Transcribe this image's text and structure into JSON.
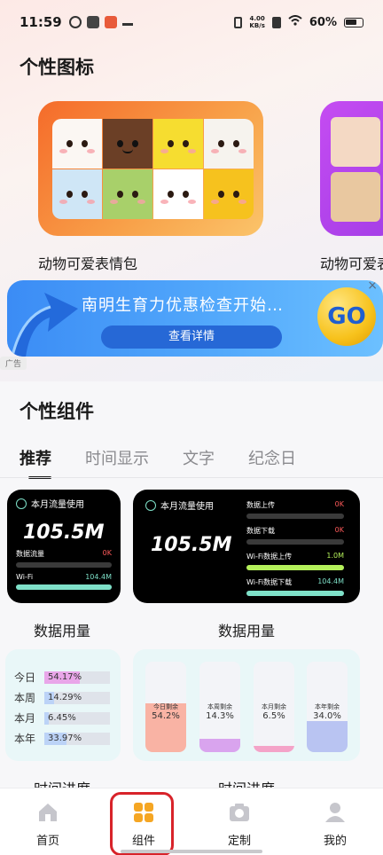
{
  "status_bar": {
    "time": "11:59",
    "speed_value": "4.00",
    "speed_unit": "KB/s",
    "battery": "60%"
  },
  "icons_section": {
    "title": "个性图标",
    "packs": [
      {
        "name": "动物可爱表情包"
      },
      {
        "name": "动物可爱表"
      }
    ]
  },
  "ad": {
    "headline": "南明生育力优惠检查开始…",
    "button_label": "查看详情",
    "go_label": "GO",
    "close_label": "×",
    "tag": "广告"
  },
  "widgets_section": {
    "title": "个性组件",
    "tabs": [
      "推荐",
      "时间显示",
      "文字",
      "纪念日"
    ],
    "active_tab": "推荐"
  },
  "data_widget_small": {
    "header": "本月流量使用",
    "big_value": "105.5M",
    "row1_label": "数据流量",
    "row1_value": "0K",
    "row2_label": "Wi-Fi",
    "row2_value": "104.4M",
    "caption": "数据用量"
  },
  "data_widget_wide": {
    "header": "本月流量使用",
    "big_value": "105.5M",
    "rows": [
      {
        "label": "数据上传",
        "value": "0K",
        "fill": 0.0,
        "color": "#ff5a5a"
      },
      {
        "label": "数据下载",
        "value": "0K",
        "fill": 0.0,
        "color": "#ff5a5a"
      },
      {
        "label": "Wi-Fi数据上传",
        "value": "1.0M",
        "fill": 1.0,
        "color": "#b4f05a"
      },
      {
        "label": "Wi-Fi数据下载",
        "value": "104.4M",
        "fill": 1.0,
        "color": "#7ee0c8"
      }
    ],
    "caption": "数据用量"
  },
  "time_progress_list": {
    "rows": [
      {
        "label": "今日",
        "value": "54.17%",
        "fill": 0.5417,
        "color": "#e9a6e9"
      },
      {
        "label": "本周",
        "value": "14.29%",
        "fill": 0.1429,
        "color": "#bcd3f7"
      },
      {
        "label": "本月",
        "value": "6.45%",
        "fill": 0.0645,
        "color": "#bcd3f7"
      },
      {
        "label": "本年",
        "value": "33.97%",
        "fill": 0.3397,
        "color": "#bcd3f7"
      }
    ],
    "caption": "时间进度"
  },
  "time_progress_tanks": {
    "tanks": [
      {
        "label": "今日剩余",
        "value": "54.2%",
        "fill": 0.542,
        "color": "#f9b3a4"
      },
      {
        "label": "本周剩余",
        "value": "14.3%",
        "fill": 0.143,
        "color": "#d9a4ee"
      },
      {
        "label": "本月剩余",
        "value": "6.5%",
        "fill": 0.065,
        "color": "#f4a3c8"
      },
      {
        "label": "本年剩余",
        "value": "34.0%",
        "fill": 0.34,
        "color": "#b9c4f2"
      }
    ],
    "caption": "时间进度"
  },
  "nav": {
    "items": [
      {
        "label": "首页",
        "icon": "home-icon"
      },
      {
        "label": "组件",
        "icon": "grid-icon"
      },
      {
        "label": "定制",
        "icon": "camera-icon"
      },
      {
        "label": "我的",
        "icon": "person-icon"
      }
    ],
    "active_index": 1
  }
}
